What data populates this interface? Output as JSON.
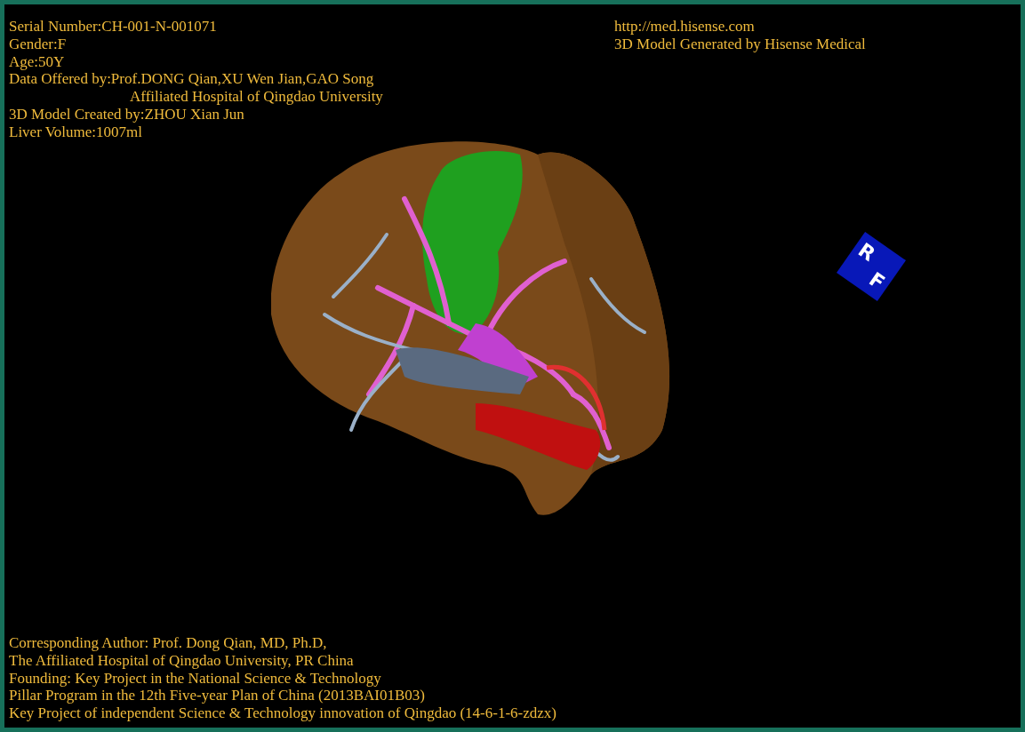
{
  "patient_info": [
    {
      "kind": "line",
      "text": "Serial Number:CH-001-N-001071"
    },
    {
      "kind": "line",
      "text": "Gender:F"
    },
    {
      "kind": "line",
      "text": "Age:50Y"
    },
    {
      "kind": "line",
      "text": "Data Offered by:Prof.DONG Qian,XU Wen Jian,GAO Song"
    },
    {
      "kind": "continuation",
      "text": "Affiliated Hospital of Qingdao University"
    },
    {
      "kind": "line",
      "text": "3D Model Created by:ZHOU Xian Jun"
    },
    {
      "kind": "line",
      "text": "Liver Volume:1007ml"
    }
  ],
  "generator_info": [
    "http://med.hisense.com",
    "3D Model Generated by Hisense Medical"
  ],
  "orientation_cube": {
    "labels": [
      "R",
      "F"
    ]
  },
  "credits": [
    "Corresponding Author: Prof. Dong Qian, MD, Ph.D,",
    "The Affiliated Hospital of Qingdao University, PR China",
    "Founding: Key Project in the National Science & Technology",
    "Pillar Program in the 12th Five-year Plan of China (2013BAI01B03)",
    "Key Project of independent Science & Technology innovation of Qingdao (14-6-1-6-zdzx)"
  ]
}
